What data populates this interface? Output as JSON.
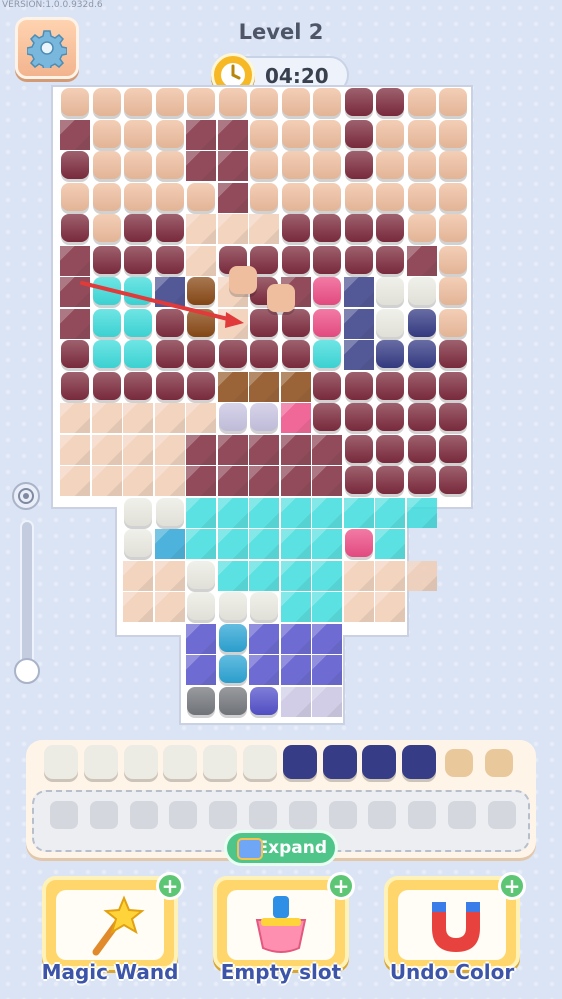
{
  "version": "VERSION:1.0.0.932d.6",
  "level_label": "Level 2",
  "timer": "04:20",
  "icons": {
    "settings": "gear-icon",
    "timer": "stopwatch-icon",
    "zoom": "target-icon",
    "expand": "clapperboard-icon",
    "magic_wand": "star-wand-icon",
    "empty_slot": "brush-icon",
    "undo_color": "magnet-icon"
  },
  "colors": {
    "maroon": "#7e2c3e",
    "peach": "#efbe9e",
    "tan": "#f1cdb5",
    "cyan": "#3fdcdc",
    "navy": "#363c86",
    "indigo": "#5552cc",
    "brown": "#8a4a16",
    "pink": "#ee4e86",
    "white": "#ecece4",
    "gray": "#76797e",
    "lavender": "#c9c5e3",
    "teal": "#2ea6d6",
    "sand": "#e9c89c"
  },
  "tray": {
    "tiles": [
      "white",
      "white",
      "white",
      "white",
      "white",
      "white",
      "navy",
      "navy",
      "navy",
      "navy",
      "sand",
      "sand"
    ],
    "slot_count": 12,
    "expand_label": "Expand"
  },
  "boosters": [
    {
      "label": "Magic Wand"
    },
    {
      "label": "Empty slot"
    },
    {
      "label": "Undo Color"
    }
  ]
}
